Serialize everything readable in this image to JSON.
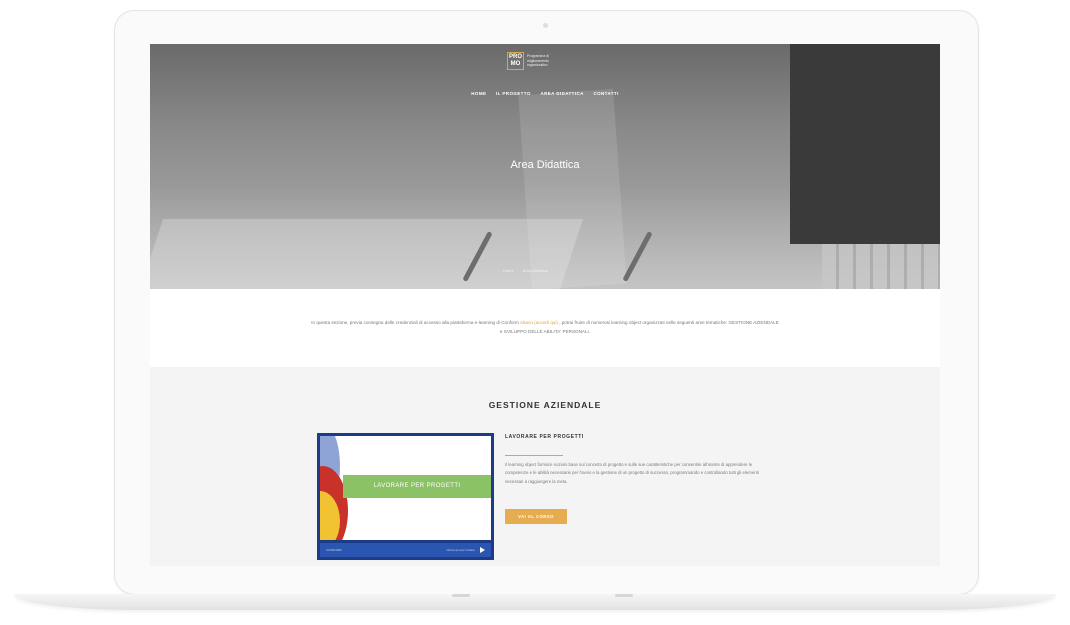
{
  "logo": {
    "mark": "PRO MO",
    "subtitle": "Programma di miglioramento organizzativo"
  },
  "nav": {
    "items": [
      "HOME",
      "IL PROGETTO",
      "AREA DIDATTICA",
      "CONTATTI"
    ]
  },
  "hero": {
    "title": "Area Didattica",
    "breadcrumb": [
      "Home",
      "Area Didattica"
    ]
  },
  "intro": {
    "text_before": "In questa sezione, previa consegna delle credenziali di accesso alla piattaforma e-learning di Conform",
    "link": " Abaco (accedi qui) ",
    "text_after": ", potrai fruire di numerosi learning object organizzati nelle seguenti aree tematiche: GESTIONE AZIENDALE e SVILUPPO DELLE ABILITA' PERSONALI."
  },
  "section": {
    "title": "GESTIONE AZIENDALE",
    "course": {
      "thumb_label": "LAVORARE PER PROGETTI",
      "thumb_brand": "CONFORM",
      "thumb_footer": "Clicca qui per iniziare",
      "title": "LAVORARE PER PROGETTI",
      "description": "Il learning object fornisce nozioni base sul concetto di progetto e sulle sue caratteristiche per consentire all'utente di apprendere le competenze e le abilità necessarie per l'avvio e la gestione di un progetto di successo, programmando e controllando tutti gli elementi necessari a raggiungere la meta.",
      "button": "VAI AL CORSO"
    }
  },
  "colors": {
    "accent": "#e5ad4f",
    "link": "#d9a645",
    "thumb_frame": "#1c3c88",
    "thumb_band": "#8cc266"
  }
}
